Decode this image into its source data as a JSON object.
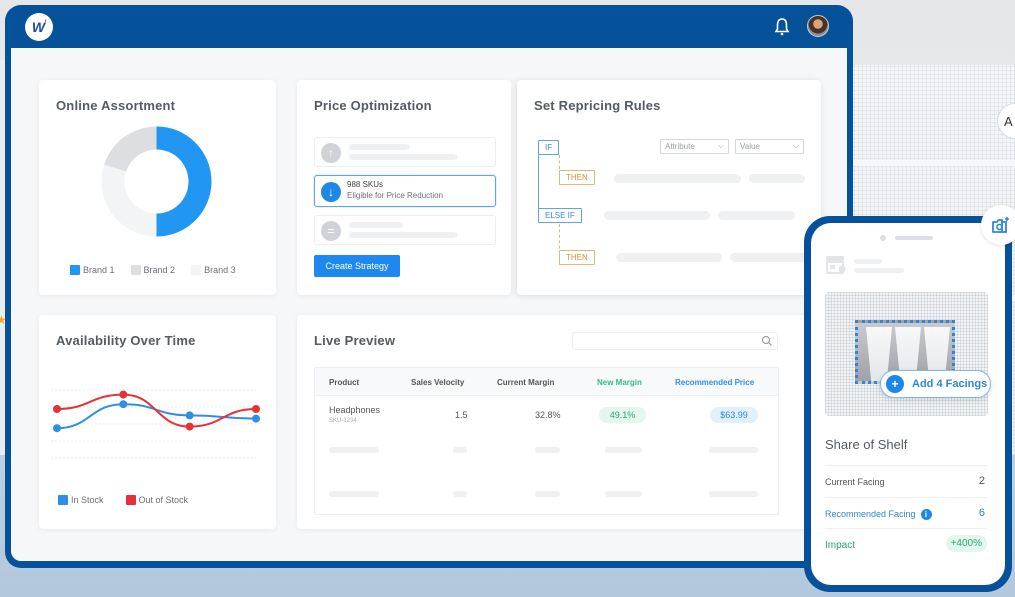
{
  "app": {
    "logo_letter": "W",
    "logo_mark": "'",
    "notifications_icon": "bell-icon",
    "avatar_icon": "user-avatar"
  },
  "background": {
    "partial_button_label": "A"
  },
  "online_assortment": {
    "title": "Online Assortment",
    "legend": [
      {
        "label": "Brand 1",
        "color": "#2196f3"
      },
      {
        "label": "Brand 2",
        "color": "#dcdee1"
      },
      {
        "label": "Brand 3",
        "color": "#f3f4f5"
      }
    ]
  },
  "price_optimization": {
    "title": "Price Optimization",
    "options": [
      {
        "icon": "arrow-up-icon",
        "title": "",
        "subtitle": "",
        "active": false
      },
      {
        "icon": "arrow-down-icon",
        "title": "988 SKUs",
        "subtitle": "Eligible for Price Reduction",
        "active": true
      },
      {
        "icon": "equals-icon",
        "title": "",
        "subtitle": "",
        "active": false
      }
    ],
    "button_label": "Create Strategy"
  },
  "repricing_rules": {
    "title": "Set Repricing Rules",
    "if_label": "IF",
    "then_label": "THEN",
    "else_if_label": "ELSE IF",
    "then2_label": "THEN",
    "attribute_select": "Attribute",
    "value_select": "Value"
  },
  "availability": {
    "title": "Availability Over Time"
  },
  "chart_data": [
    {
      "type": "pie",
      "title": "Online Assortment",
      "categories": [
        "Brand 1",
        "Brand 2",
        "Brand 3"
      ],
      "values": [
        50,
        20,
        30
      ],
      "colors": [
        "#2196f3",
        "#dcdee1",
        "#f3f4f5"
      ],
      "donut": true,
      "legend": "bottom"
    },
    {
      "type": "line",
      "title": "Availability Over Time",
      "x": [
        1,
        2,
        3,
        4
      ],
      "series": [
        {
          "name": "In Stock",
          "color": "#2f8ee6",
          "values": [
            2.3,
            3.8,
            3.1,
            2.9
          ]
        },
        {
          "name": "Out of Stock",
          "color": "#e53238",
          "values": [
            3.5,
            4.4,
            2.4,
            3.5
          ]
        }
      ],
      "ylim": [
        0,
        6
      ],
      "grid": true,
      "legend": "bottom-left",
      "xlabel": "",
      "ylabel": ""
    }
  ],
  "live_preview": {
    "title": "Live Preview",
    "search_placeholder": "",
    "columns": [
      "Product",
      "Sales Velocity",
      "Current Margin",
      "New Margin",
      "Recommended Price"
    ],
    "rows": [
      {
        "product": "Headphones",
        "sku": "SKU-1234",
        "sales_velocity": "1.5",
        "current_margin": "32.8%",
        "new_margin": "49.1%",
        "recommended_price": "$63.99"
      }
    ]
  },
  "mobile": {
    "add_facings_label": "Add 4 Facings",
    "share_of_shelf_title": "Share of Shelf",
    "current_facing_label": "Current Facing",
    "current_facing_value": "2",
    "recommended_facing_label": "Recommended Facing",
    "recommended_facing_value": "6",
    "impact_label": "Impact",
    "impact_value": "+400%",
    "info_glyph": "i"
  }
}
